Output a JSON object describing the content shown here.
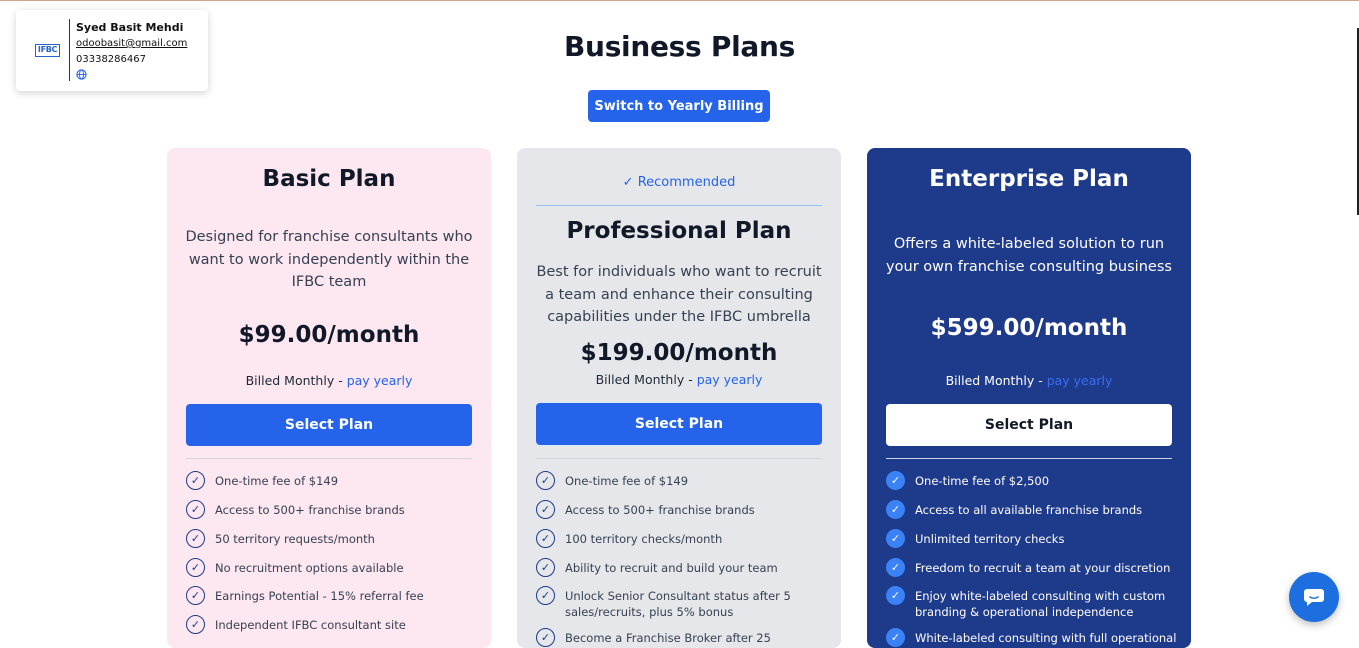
{
  "profile": {
    "name": "Syed Basit Mehdi",
    "email": "odoobasit@gmail.com",
    "phone": "03338286467",
    "logo_text": "IFBC"
  },
  "page": {
    "title": "Business Plans",
    "toggle_label": "Switch to Yearly Billing"
  },
  "plans": {
    "basic": {
      "name": "Basic Plan",
      "description": "Designed for franchise consultants who want to work independently within the IFBC team",
      "price": "$99.00/month",
      "billed": "Billed Monthly - ",
      "pay_link": "pay yearly",
      "button": "Select Plan",
      "features": [
        "One-time fee of $149",
        "Access to 500+ franchise brands",
        "50 territory requests/month",
        "No recruitment options available",
        "Earnings Potential - 15% referral fee",
        "Independent IFBC consultant site"
      ]
    },
    "professional": {
      "badge": "Recommended",
      "name": "Professional Plan",
      "description": "Best for individuals who want to recruit a team and enhance their consulting capabilities under the IFBC umbrella",
      "price": "$199.00/month",
      "billed": "Billed Monthly - ",
      "pay_link": "pay yearly",
      "button": "Select Plan",
      "features": [
        "One-time fee of $149",
        "Access to 500+ franchise brands",
        "100 territory checks/month",
        "Ability to recruit and build your team",
        "Unlock Senior Consultant status after 5 sales/recruits, plus 5% bonus",
        "Become a Franchise Broker after 25"
      ]
    },
    "enterprise": {
      "name": "Enterprise Plan",
      "description": "Offers a white-labeled solution to run your own franchise consulting business",
      "price": "$599.00/month",
      "billed": "Billed Monthly - ",
      "pay_link": "pay yearly",
      "button": "Select Plan",
      "features": [
        "One-time fee of $2,500",
        "Access to all available franchise brands",
        "Unlimited territory checks",
        "Freedom to recruit a team at your discretion",
        "Enjoy white-labeled consulting with custom branding & operational independence",
        "White-labeled consulting with full operational"
      ]
    }
  },
  "icons": {
    "check": "check-circle-icon",
    "globe": "globe-icon",
    "chat": "chat-bubble-icon"
  },
  "colors": {
    "accent": "#2563eb",
    "basic_bg": "#fde7f1",
    "pro_bg": "#e5e7eb",
    "enterprise_bg": "#1e3a8a"
  }
}
